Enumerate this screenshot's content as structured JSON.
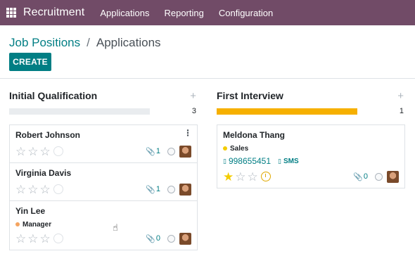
{
  "navbar": {
    "brand": "Recruitment",
    "items": [
      "Applications",
      "Reporting",
      "Configuration"
    ]
  },
  "breadcrumb": {
    "parent": "Job Positions",
    "separator": "/",
    "current": "Applications"
  },
  "actions": {
    "create": "CREATE"
  },
  "colors": {
    "brand": "#714B67",
    "accent": "#017e84",
    "progress": "#f6b000"
  },
  "columns": [
    {
      "title": "Initial Qualification",
      "add": "+",
      "count": "3",
      "progress": 0,
      "cards": [
        {
          "name": "Robert Johnson",
          "tag": "",
          "attachments": "1",
          "stars": 0,
          "menu": "⋮"
        },
        {
          "name": "Virginia Davis",
          "tag": "",
          "attachments": "1",
          "stars": 0
        },
        {
          "name": "Yin Lee",
          "tag": "Manager",
          "tag_color": "#f4a460",
          "attachments": "0",
          "stars": 0
        }
      ]
    },
    {
      "title": "First Interview",
      "add": "+",
      "count": "1",
      "progress": 1,
      "cards": [
        {
          "name": "Meldona Thang",
          "tag": "Sales",
          "tag_color": "#f3cc00",
          "phone": "998655451",
          "sms": "SMS",
          "attachments": "0",
          "stars": 1
        }
      ]
    }
  ]
}
